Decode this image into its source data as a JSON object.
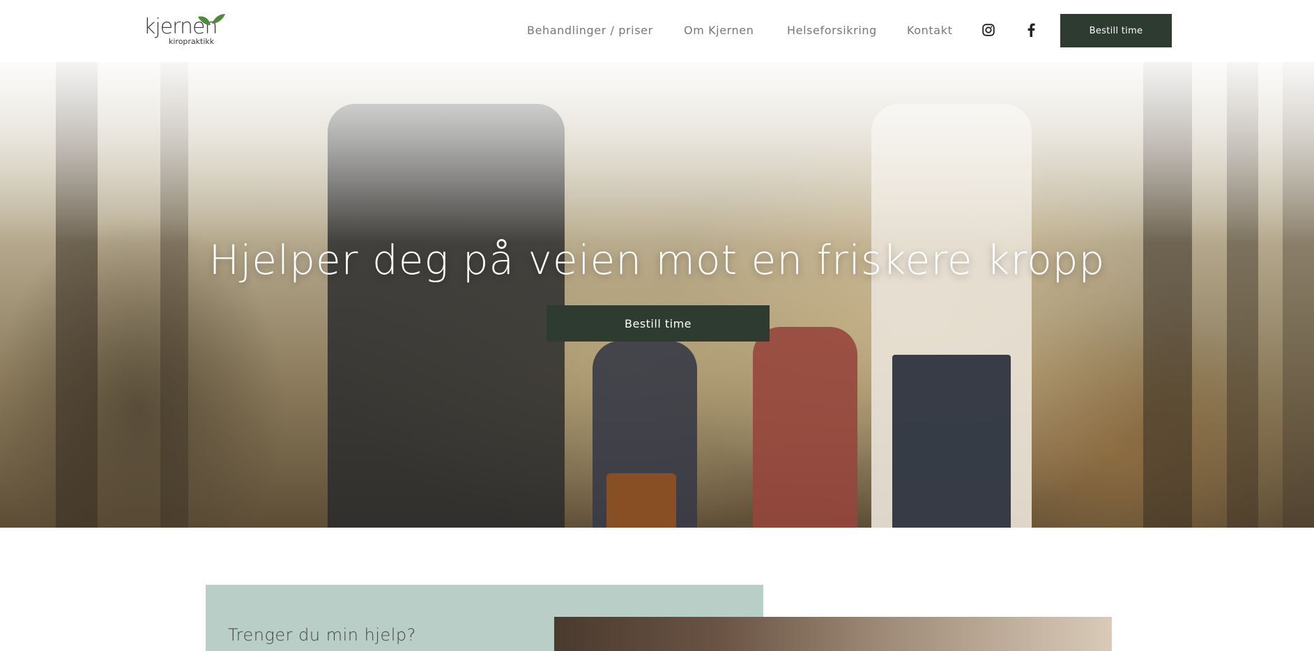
{
  "header": {
    "logo_text": "kjernen",
    "logo_sub": "kiropraktikk",
    "nav": [
      {
        "label": "Behandlinger / priser"
      },
      {
        "label": "Om Kjernen"
      },
      {
        "label": "Helseforsikring"
      },
      {
        "label": "Kontakt"
      }
    ],
    "social": [
      {
        "icon": "instagram-icon"
      },
      {
        "icon": "facebook-icon"
      }
    ],
    "cta_label": "Bestill time"
  },
  "hero": {
    "title": "Hjelper deg på veien mot en friskere kropp",
    "cta_label": "Bestill time"
  },
  "help": {
    "title": "Trenger du min hjelp?"
  },
  "colors": {
    "brand_dark": "#2e3b31",
    "card_bg": "#b9cec6",
    "leaf_green": "#4e8a3a"
  }
}
